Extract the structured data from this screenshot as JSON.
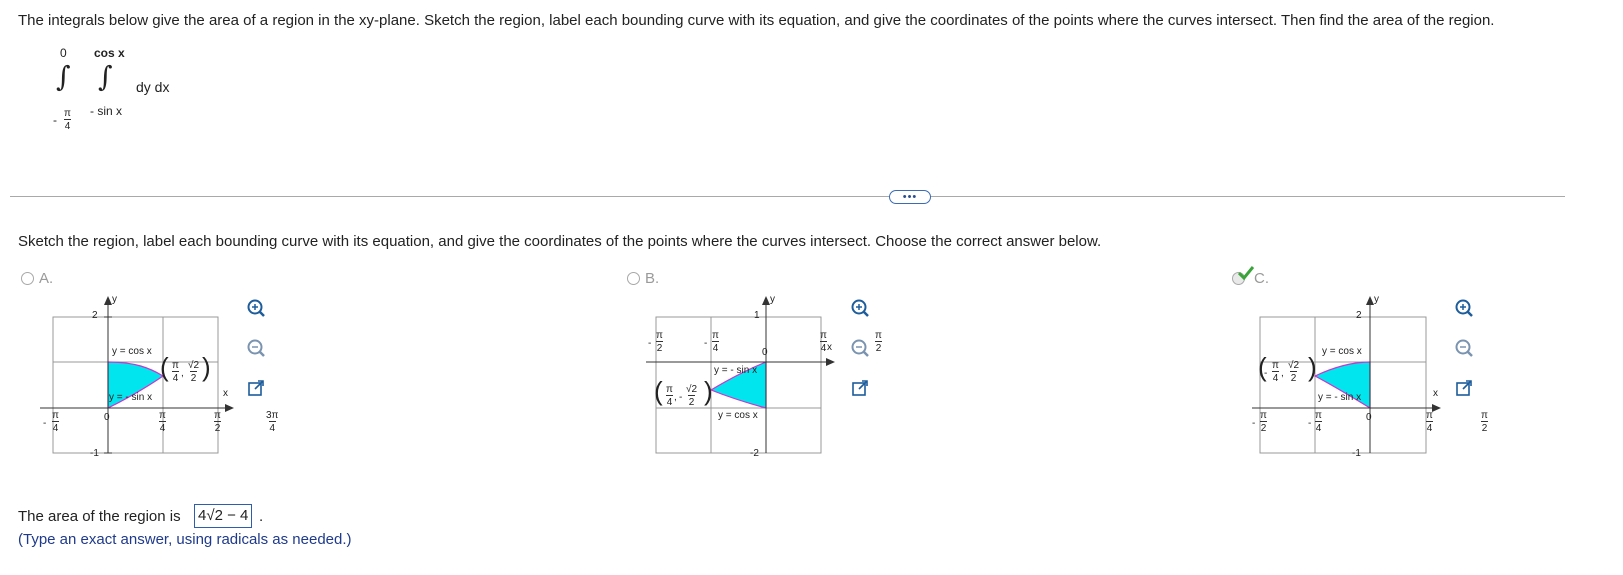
{
  "question": {
    "prompt": "The integrals below give the area of a region in the xy-plane. Sketch the region, label each bounding curve with its equation, and give the coordinates of the points where the curves intersect. Then find the area of the region.",
    "integral": {
      "outer_upper": "0",
      "outer_lower_sign": "-",
      "outer_lower_num": "π",
      "outer_lower_den": "4",
      "inner_upper": "cos x",
      "inner_lower": "- sin x",
      "integrand": "dy dx"
    }
  },
  "more_button": "•••",
  "part_prompt": "Sketch the region, label each bounding curve with its equation, and give the coordinates of the points where the curves intersect. Choose the correct answer below.",
  "options": [
    {
      "label": "A.",
      "selected": false,
      "graph": {
        "y_top": "2",
        "y_bottom": "-1",
        "y_axis": "y",
        "x_axis": "x",
        "origin": "0",
        "curve_upper": "y = cos x",
        "curve_lower": "y = - sin x",
        "x_ticks": [
          {
            "sign": "-",
            "num": "π",
            "den": "4"
          },
          {
            "sign": "",
            "num": "π",
            "den": "4"
          },
          {
            "sign": "",
            "num": "π",
            "den": "2"
          },
          {
            "sign": "",
            "num": "3π",
            "den": "4"
          }
        ],
        "point": {
          "x": "π",
          "x_den": "4",
          "y": "√2",
          "y_den": "2"
        }
      }
    },
    {
      "label": "B.",
      "selected": false,
      "graph": {
        "y_top": "1",
        "y_bottom": "-2",
        "y_axis": "y",
        "x_axis": "x",
        "origin": "0",
        "curve_upper": "y = - sin x",
        "curve_lower": "y = cos x",
        "x_ticks": [
          {
            "sign": "-",
            "num": "π",
            "den": "2"
          },
          {
            "sign": "-",
            "num": "π",
            "den": "4"
          },
          {
            "sign": "",
            "num": "π",
            "den": "4"
          },
          {
            "sign": "",
            "num": "π",
            "den": "2"
          }
        ],
        "point": {
          "x": "π",
          "x_den": "4",
          "y": "√2",
          "y_den": "2",
          "y_sign": "-"
        }
      }
    },
    {
      "label": "C.",
      "selected": true,
      "graph": {
        "y_top": "2",
        "y_bottom": "-1",
        "y_axis": "y",
        "x_axis": "x",
        "origin": "0",
        "curve_upper": "y = cos x",
        "curve_lower": "y = - sin x",
        "x_ticks": [
          {
            "sign": "-",
            "num": "π",
            "den": "2"
          },
          {
            "sign": "-",
            "num": "π",
            "den": "4"
          },
          {
            "sign": "",
            "num": "π",
            "den": "4"
          },
          {
            "sign": "",
            "num": "π",
            "den": "2"
          }
        ],
        "point": {
          "x": "π",
          "x_den": "4",
          "x_sign": "-",
          "y": "√2",
          "y_den": "2"
        }
      }
    }
  ],
  "tools": [
    "zoom-in-icon",
    "zoom-out-icon",
    "open-external-icon"
  ],
  "area": {
    "prefix": "The area of the region is",
    "value": "4√2 − 4",
    "suffix": ".",
    "hint": "(Type an exact answer, using radicals as needed.)"
  },
  "colors": {
    "fill": "#00e5ee",
    "curve": "#cc33cc",
    "check": "#3aa43a",
    "link": "#1f3a8c"
  }
}
